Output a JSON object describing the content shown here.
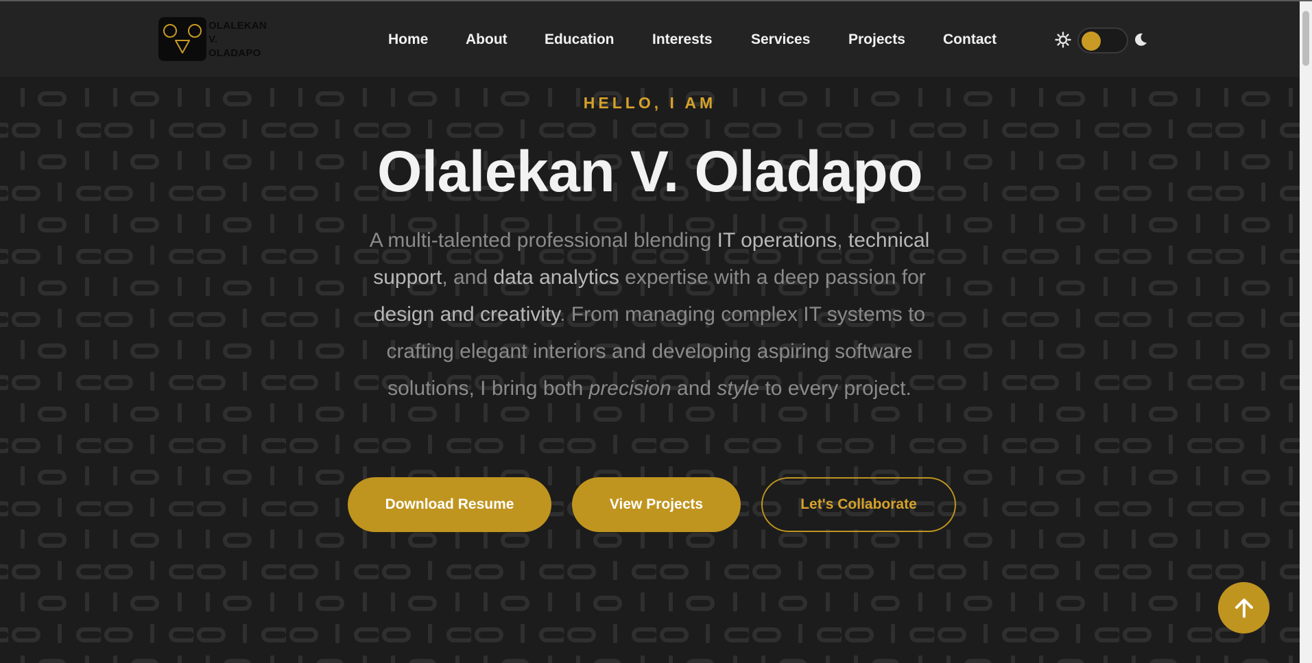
{
  "brand": {
    "logo_icon": "owl-face-logo",
    "logo_lines": [
      "OLALEKAN",
      "V.",
      "OLADAPO"
    ]
  },
  "nav": {
    "items": [
      {
        "label": "Home"
      },
      {
        "label": "About"
      },
      {
        "label": "Education"
      },
      {
        "label": "Interests"
      },
      {
        "label": "Services"
      },
      {
        "label": "Projects"
      },
      {
        "label": "Contact"
      }
    ]
  },
  "theme_toggle": {
    "light_icon": "sun-icon",
    "dark_icon": "moon-icon",
    "state": "dark"
  },
  "hero": {
    "eyebrow": "HELLO, I AM",
    "name": "Olalekan V. Oladapo",
    "intro": {
      "t1": "A multi-talented professional blending ",
      "e1": "IT operations",
      "t2": ", ",
      "e2": "technical support",
      "t3": ", and ",
      "e3": "data analytics",
      "t4": " expertise with a deep passion for ",
      "e4": "design and creativity",
      "t5": ". From managing complex IT systems to crafting elegant interiors and developing aspiring software solutions, I bring both ",
      "i1": "precision",
      "t6": " and ",
      "i2": "style",
      "t7": " to every project."
    },
    "buttons": {
      "download": "Download Resume",
      "projects": "View Projects",
      "collaborate": "Let's Collaborate"
    }
  },
  "scroll_top": {
    "icon": "arrow-up-icon"
  },
  "colors": {
    "accent": "#c0951f",
    "accent_text": "#d6a22a",
    "background": "#1c1c1c",
    "header": "#232323"
  }
}
